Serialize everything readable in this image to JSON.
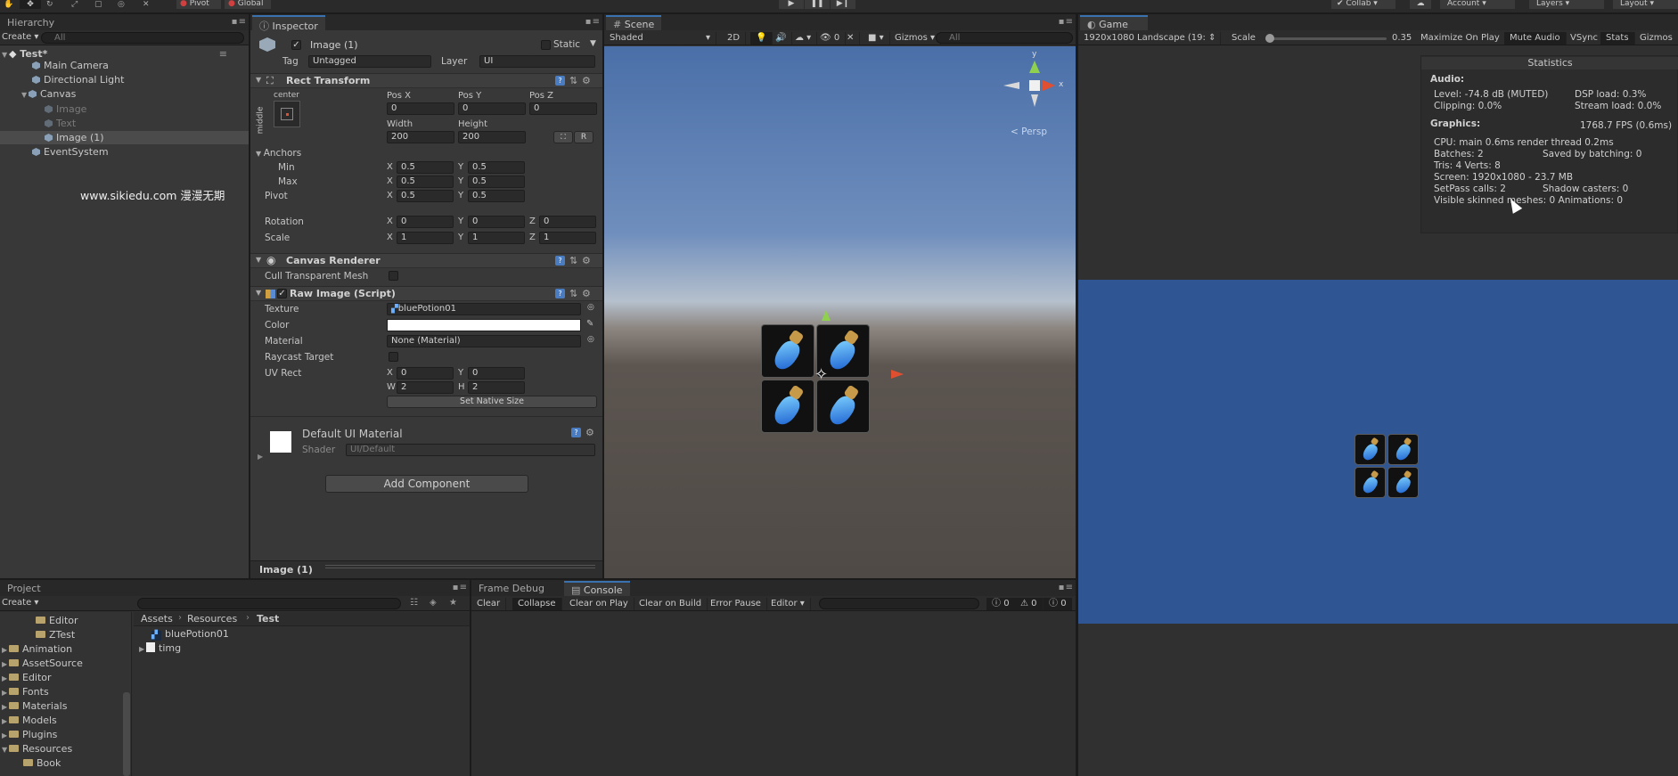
{
  "toolbar": {
    "pivot": "Pivot",
    "global": "Global",
    "collab": "Collab",
    "account": "Account",
    "layers": "Layers",
    "layout": "Layout"
  },
  "hierarchy": {
    "tab": "Hierarchy",
    "create": "Create",
    "search": "All",
    "scene": "Test*",
    "items": [
      "Main Camera",
      "Directional Light",
      "Canvas",
      "Image",
      "Text",
      "Image (1)",
      "EventSystem"
    ],
    "watermark": "www.sikiedu.com 漫漫无期"
  },
  "inspector": {
    "tab": "Inspector",
    "object_name": "Image (1)",
    "static": "Static",
    "tag_label": "Tag",
    "tag_value": "Untagged",
    "layer_label": "Layer",
    "layer_value": "UI",
    "rect_transform": "Rect Transform",
    "anchor_h": "center",
    "anchor_v": "middle",
    "posx_label": "Pos X",
    "posy_label": "Pos Y",
    "posz_label": "Pos Z",
    "posx": "0",
    "posy": "0",
    "posz": "0",
    "width_label": "Width",
    "height_label": "Height",
    "width": "200",
    "height": "200",
    "r": "R",
    "anchors": "Anchors",
    "min": "Min",
    "max": "Max",
    "pivot": "Pivot",
    "rotation": "Rotation",
    "scale": "Scale",
    "x": "X",
    "y": "Y",
    "z": "Z",
    "min_x": "0.5",
    "min_y": "0.5",
    "max_x": "0.5",
    "max_y": "0.5",
    "pivot_x": "0.5",
    "pivot_y": "0.5",
    "rot_x": "0",
    "rot_y": "0",
    "rot_z": "0",
    "scale_x": "1",
    "scale_y": "1",
    "scale_z": "1",
    "canvas_renderer": "Canvas Renderer",
    "cull": "Cull Transparent Mesh",
    "raw_image": "Raw Image (Script)",
    "texture_label": "Texture",
    "texture_value": "bluePotion01",
    "color_label": "Color",
    "material_label": "Material",
    "material_value": "None (Material)",
    "raycast": "Raycast Target",
    "uvrect": "UV Rect",
    "uv_x": "0",
    "uv_y": "0",
    "w": "W",
    "h": "H",
    "uv_w": "2",
    "uv_h": "2",
    "native": "Set Native Size",
    "default_mat": "Default UI Material",
    "shader_label": "Shader",
    "shader_value": "UI/Default",
    "add_component": "Add Component",
    "footer": "Image (1)"
  },
  "scene": {
    "tab": "Scene",
    "shaded": "Shaded",
    "mode2d": "2D",
    "gizmos": "Gizmos",
    "search": "All",
    "persp": "< Persp",
    "fx": "0"
  },
  "game": {
    "tab": "Game",
    "resolution": "1920x1080 Landscape (19:",
    "scale_label": "Scale",
    "scale_value": "0.35",
    "maximize": "Maximize On Play",
    "mute": "Mute Audio",
    "vsync": "VSync",
    "stats": "Stats",
    "gizmos": "Gizmos"
  },
  "statistics": {
    "title": "Statistics",
    "audio": "Audio:",
    "level": "Level: -74.8 dB (MUTED)",
    "dsp": "DSP load: 0.3%",
    "clipping": "Clipping: 0.0%",
    "stream": "Stream load: 0.0%",
    "graphics": "Graphics:",
    "fps": "1768.7 FPS (0.6ms)",
    "cpu": "CPU: main 0.6ms  render thread 0.2ms",
    "batches": "Batches: 2",
    "saved": "Saved by batching: 0",
    "tris": "Tris: 4     Verts: 8",
    "screen": "Screen: 1920x1080 - 23.7 MB",
    "setpass": "SetPass calls: 2",
    "shadow": "Shadow casters: 0",
    "skinned": "Visible skinned meshes: 0  Animations: 0"
  },
  "project": {
    "tab": "Project",
    "create": "Create",
    "folders": [
      "Editor",
      "ZTest",
      "Animation",
      "AssetSource",
      "Editor",
      "Fonts",
      "Materials",
      "Models",
      "Plugins",
      "Resources",
      "Book"
    ],
    "crumb": [
      "Assets",
      "Resources",
      "Test"
    ],
    "files": [
      "bluePotion01",
      "timg"
    ]
  },
  "console": {
    "tab_frame": "Frame Debug",
    "tab": "Console",
    "clear": "Clear",
    "collapse": "Collapse",
    "clear_play": "Clear on Play",
    "clear_build": "Clear on Build",
    "error_pause": "Error Pause",
    "editor": "Editor",
    "c_info": "0",
    "c_warn": "0",
    "c_err": "0"
  },
  "colors": {
    "accent": "#3a72b0",
    "game_bg": "#2f5592",
    "sky_top": "#4a6fa8",
    "ground": "#5c5550"
  }
}
